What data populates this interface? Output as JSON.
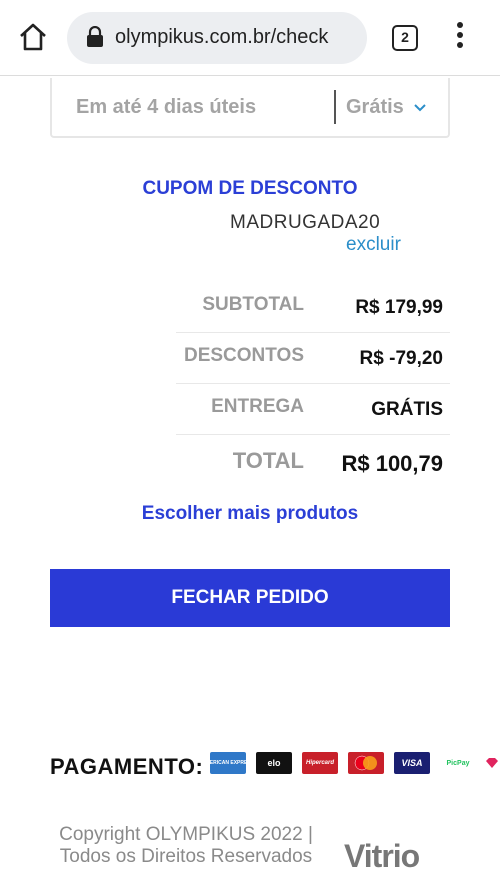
{
  "browser": {
    "url": "olympikus.com.br/check",
    "tab_count": "2"
  },
  "shipping": {
    "time": "Em até 4 dias úteis",
    "price": "Grátis"
  },
  "coupon": {
    "title": "CUPOM DE DESCONTO",
    "code": "MADRUGADA20",
    "remove_label": "excluir"
  },
  "summary": {
    "rows": [
      {
        "label": "SUBTOTAL",
        "value": "R$ 179,99"
      },
      {
        "label": "DESCONTOS",
        "value": "R$ -79,20"
      },
      {
        "label": "ENTREGA",
        "value": "GRÁTIS"
      },
      {
        "label": "TOTAL",
        "value": "R$ 100,79"
      }
    ]
  },
  "more_products_label": "Escolher mais produtos",
  "checkout_label": "FECHAR PEDIDO",
  "payment": {
    "label": "PAGAMENTO:",
    "methods": [
      {
        "name": "American Express",
        "text": "AMERICAN EXPRESS",
        "color": "#2f78c8"
      },
      {
        "name": "Elo",
        "text": "elo",
        "color": "#111111"
      },
      {
        "name": "Hipercard",
        "text": "Hipercard",
        "color": "#c8202a"
      },
      {
        "name": "Mastercard",
        "text": "mastercard",
        "color": "#c8202a"
      },
      {
        "name": "Visa",
        "text": "VISA",
        "color": "#1a1f71"
      },
      {
        "name": "PicPay",
        "text": "PicPay",
        "color": "#21c25e"
      },
      {
        "name": "Diners",
        "text": "",
        "color": "#e0245e"
      }
    ]
  },
  "footer": {
    "copyright": "Copyright OLYMPIKUS 2022 | Todos os Direitos Reservados",
    "brand": "Vitrio"
  }
}
